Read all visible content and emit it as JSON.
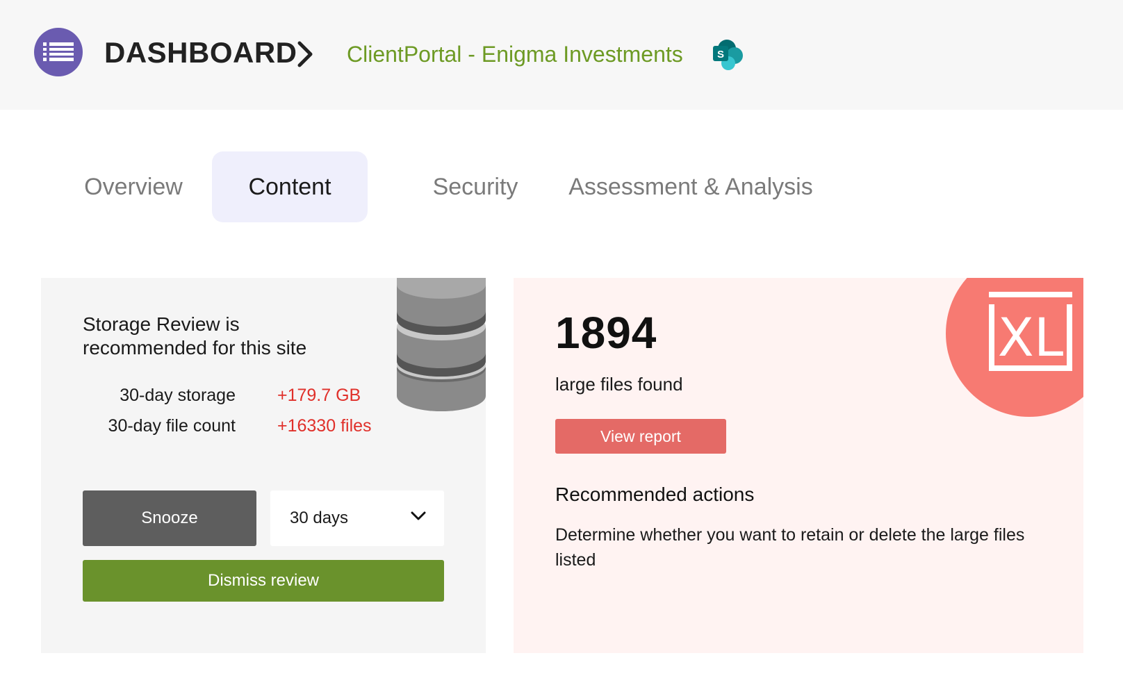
{
  "header": {
    "title": "DASHBOARD",
    "site_name": "ClientPortal - Enigma Investments",
    "sp_letter": "S",
    "brand_color": "#6a5bb0",
    "site_color": "#6d9a24"
  },
  "tabs": [
    {
      "label": "Overview",
      "active": false
    },
    {
      "label": "Content",
      "active": true
    },
    {
      "label": "Security",
      "active": false
    },
    {
      "label": "Assessment & Analysis",
      "active": false
    }
  ],
  "storage_card": {
    "heading": "Storage Review is recommended for this site",
    "stats": [
      {
        "label": "30-day storage",
        "value": "+179.7 GB"
      },
      {
        "label": "30-day file count",
        "value": "+16330 files"
      }
    ],
    "snooze_label": "Snooze",
    "snooze_duration": "30 days",
    "dismiss_label": "Dismiss review",
    "icon": "database-icon"
  },
  "large_files_card": {
    "count": "1894",
    "count_label": "large files found",
    "view_report_label": "View report",
    "recommended_heading": "Recommended actions",
    "recommended_text": "Determine whether you want to retain or delete the large files listed",
    "icon_text": "XL",
    "icon": "xl-file-icon"
  }
}
